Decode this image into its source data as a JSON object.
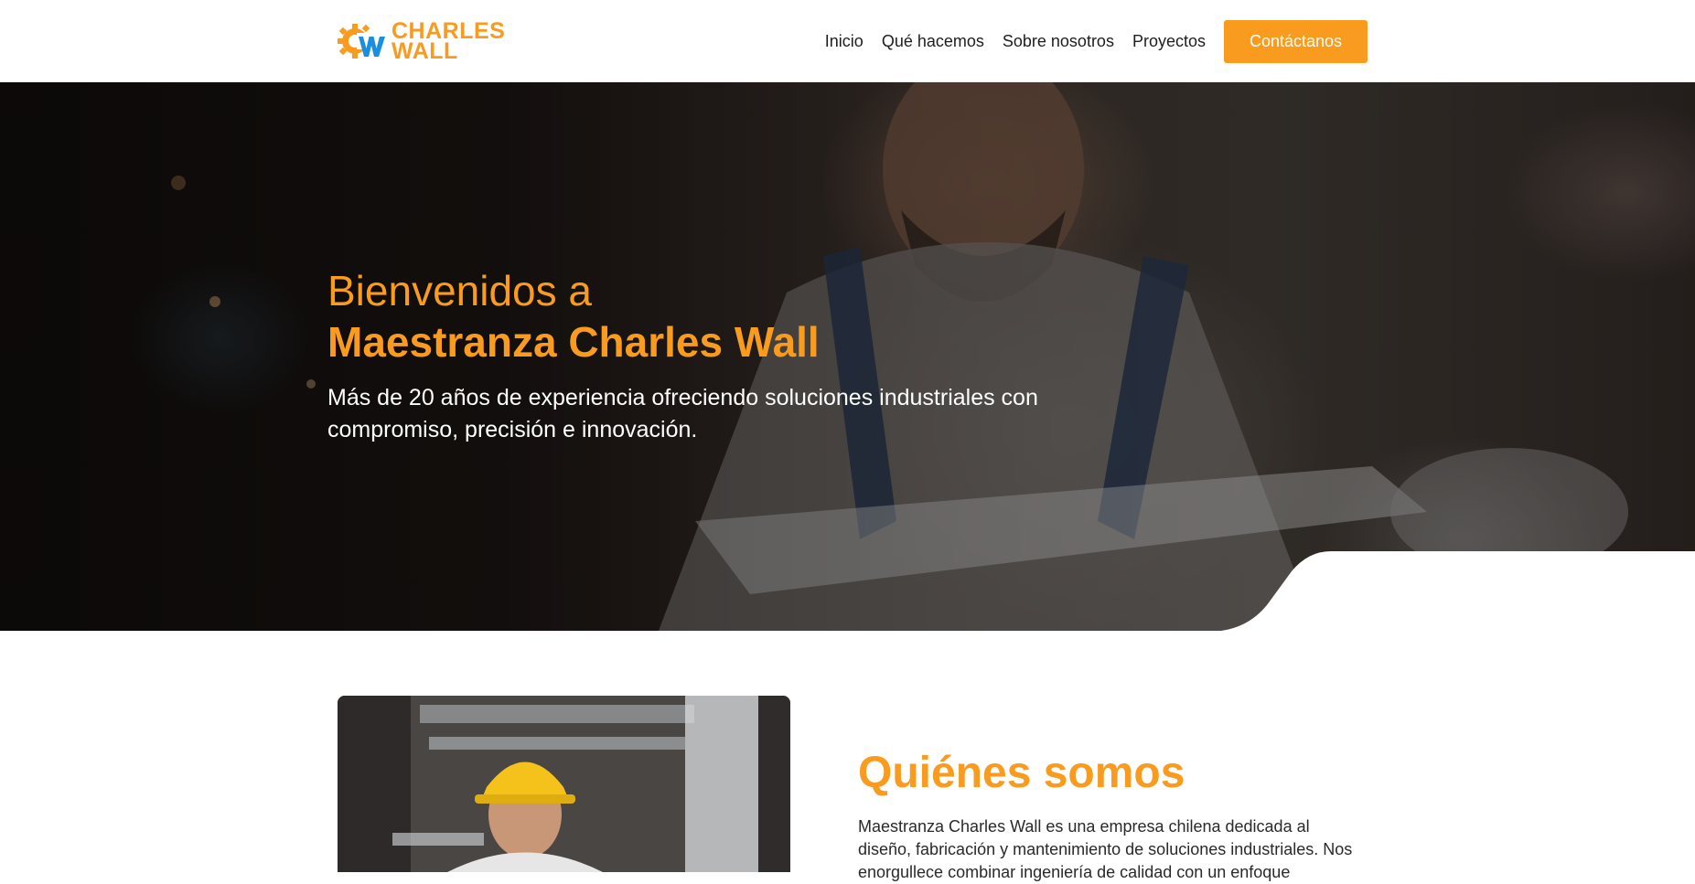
{
  "brand": {
    "name_line1": "CHARLES",
    "name_line2": "WALL",
    "accent_color": "#f89b1e",
    "logo_icon": "gear-cw-logo-icon"
  },
  "nav": {
    "items": [
      {
        "label": "Inicio"
      },
      {
        "label": "Qué hacemos"
      },
      {
        "label": "Sobre nosotros"
      },
      {
        "label": "Proyectos"
      }
    ],
    "cta_label": "Contáctanos"
  },
  "hero": {
    "title_line1": "Bienvenidos a",
    "title_line2": "Maestranza Charles Wall",
    "subtitle": "Más de 20 años de experiencia ofreciendo soluciones industriales con compromiso, precisión e innovación.",
    "background_image": "industrial-worker-photo"
  },
  "about": {
    "image": "worker-with-yellow-helmet-photo",
    "title": "Quiénes somos",
    "text": "Maestranza Charles Wall es una empresa chilena dedicada al diseño, fabricación y mantenimiento de soluciones industriales. Nos enorgullece combinar ingeniería de calidad con un enfoque"
  }
}
